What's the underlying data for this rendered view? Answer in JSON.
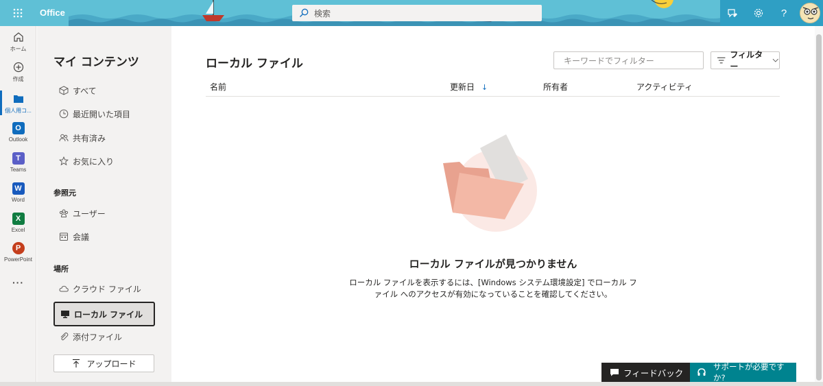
{
  "header": {
    "brand": "Office",
    "search_placeholder": "検索"
  },
  "rail": {
    "items": [
      {
        "label": "ホーム",
        "icon": "home-icon"
      },
      {
        "label": "作成",
        "icon": "create-icon"
      },
      {
        "label": "個人用コ...",
        "icon": "folder-icon",
        "active": true
      },
      {
        "label": "Outlook",
        "icon": "outlook-icon"
      },
      {
        "label": "Teams",
        "icon": "teams-icon"
      },
      {
        "label": "Word",
        "icon": "word-icon"
      },
      {
        "label": "Excel",
        "icon": "excel-icon"
      },
      {
        "label": "PowerPoint",
        "icon": "powerpoint-icon"
      }
    ],
    "more": "···"
  },
  "nav": {
    "title": "マイ コンテンツ",
    "items": [
      {
        "label": "すべて",
        "icon": "cube-icon"
      },
      {
        "label": "最近開いた項目",
        "icon": "clock-icon"
      },
      {
        "label": "共有済み",
        "icon": "people-icon"
      },
      {
        "label": "お気に入り",
        "icon": "star-icon"
      }
    ],
    "section_browse": "参照元",
    "browse_items": [
      {
        "label": "ユーザー",
        "icon": "group-icon"
      },
      {
        "label": "会議",
        "icon": "calendar-icon"
      }
    ],
    "section_places": "場所",
    "place_items": [
      {
        "label": "クラウド ファイル",
        "icon": "cloud-icon"
      },
      {
        "label": "ローカル ファイル",
        "icon": "monitor-icon",
        "selected": true
      },
      {
        "label": "添付ファイル",
        "icon": "paperclip-icon"
      }
    ],
    "upload": "アップロード"
  },
  "main": {
    "title": "ローカル ファイル",
    "filter_placeholder": "キーワードでフィルター",
    "filter_label": "フィルター",
    "columns": [
      "名前",
      "更新日",
      "所有者",
      "アクティビティ"
    ],
    "sort_arrow": "↓",
    "empty_title": "ローカル ファイルが見つかりません",
    "empty_desc": "ローカル ファイルを表示するには、[Windows システム環境設定] でローカル ファイル へのアクセスが有効になっていることを確認してください。"
  },
  "footer": {
    "feedback": "フィードバック",
    "support": "サポートが必要ですか?"
  },
  "colors": {
    "header_bg": "#5fc0d6",
    "header_right_bg": "#2f9fc4",
    "accent": "#0f6cbd",
    "support_bg": "#00838f",
    "feedback_bg": "#252423"
  }
}
